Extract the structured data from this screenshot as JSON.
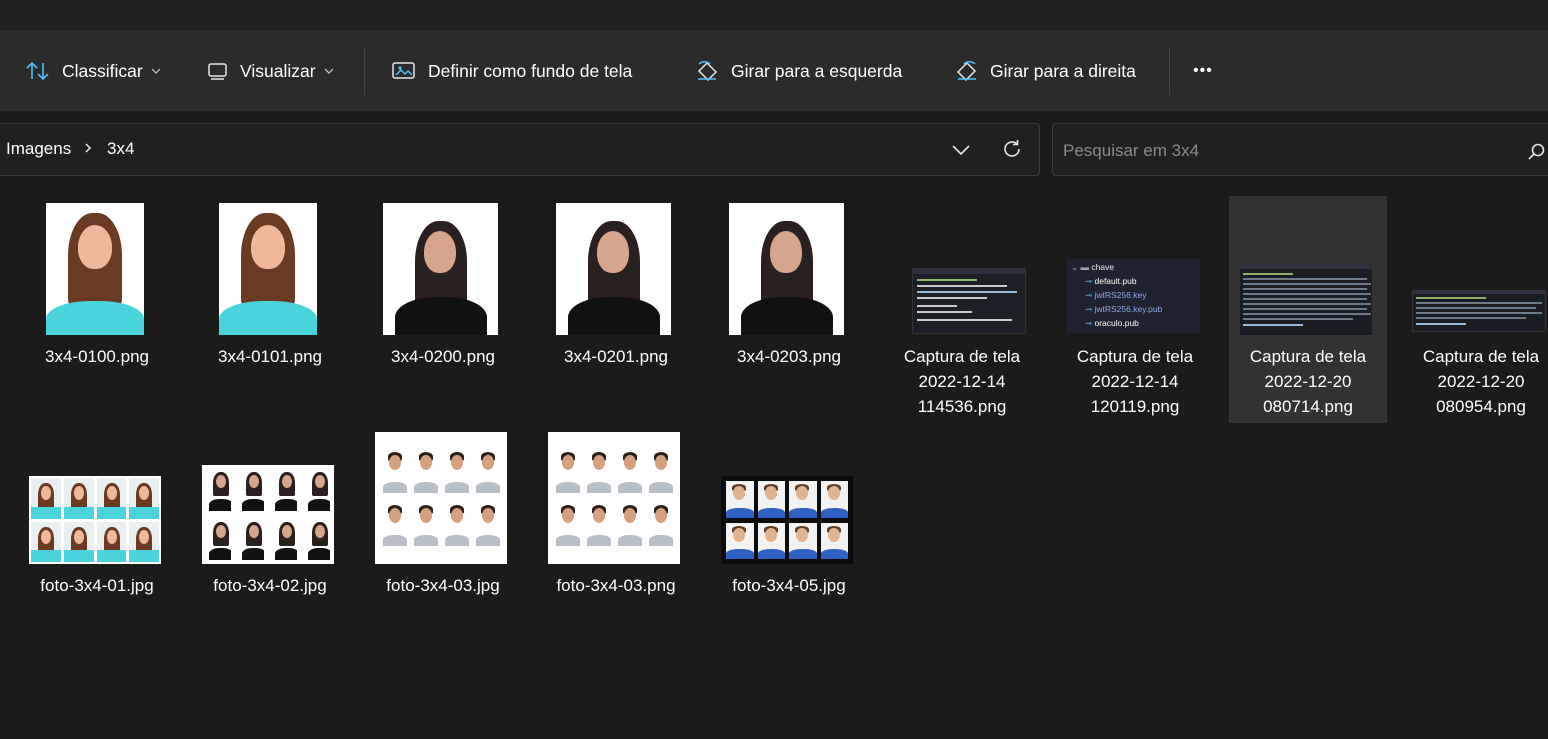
{
  "toolbar": {
    "sort_label": "Classificar",
    "view_label": "Visualizar",
    "wallpaper_label": "Definir como fundo de tela",
    "rotate_left_label": "Girar para a esquerda",
    "rotate_right_label": "Girar para a direita",
    "more_label": "•••"
  },
  "address": {
    "breadcrumb": [
      "Imagens",
      "3x4"
    ]
  },
  "search": {
    "placeholder": "Pesquisar em 3x4"
  },
  "files": [
    {
      "name": "3x4-0100.png",
      "kind": "portrait-blue"
    },
    {
      "name": "3x4-0101.png",
      "kind": "portrait-blue"
    },
    {
      "name": "3x4-0200.png",
      "kind": "portrait-black"
    },
    {
      "name": "3x4-0201.png",
      "kind": "portrait-black"
    },
    {
      "name": "3x4-0203.png",
      "kind": "portrait-black"
    },
    {
      "name": "Captura de tela 2022-12-14 114536.png",
      "line1": "Captura de tela",
      "line2": "2022-12-14",
      "line3": "114536.png",
      "kind": "screenshot-code"
    },
    {
      "name": "Captura de tela 2022-12-14 120119.png",
      "line1": "Captura de tela",
      "line2": "2022-12-14",
      "line3": "120119.png",
      "kind": "screenshot-tree",
      "tree": [
        "chave",
        "default.pub",
        "jwtRS256.key",
        "jwtRS256.key.pub",
        "oraculo.pub"
      ]
    },
    {
      "name": "Captura de tela 2022-12-20 080714.png",
      "line1": "Captura de tela",
      "line2": "2022-12-20",
      "line3": "080714.png",
      "kind": "screenshot-code",
      "selected": true
    },
    {
      "name": "Captura de tela 2022-12-20 080954.png",
      "line1": "Captura de tela",
      "line2": "2022-12-20",
      "line3": "080954.png",
      "kind": "screenshot-code"
    },
    {
      "name": "foto-3x4-01.jpg",
      "kind": "sheet-blue"
    },
    {
      "name": "foto-3x4-02.jpg",
      "kind": "sheet-black"
    },
    {
      "name": "foto-3x4-03.jpg",
      "kind": "sheet-man"
    },
    {
      "name": "foto-3x4-03.png",
      "kind": "sheet-man"
    },
    {
      "name": "foto-3x4-05.jpg",
      "kind": "sheet-boy"
    }
  ],
  "colors": {
    "accent": "#4cc2ff",
    "background": "#1b1b1b",
    "toolbar": "#2b2b2b",
    "selected_tile": "#323232"
  }
}
